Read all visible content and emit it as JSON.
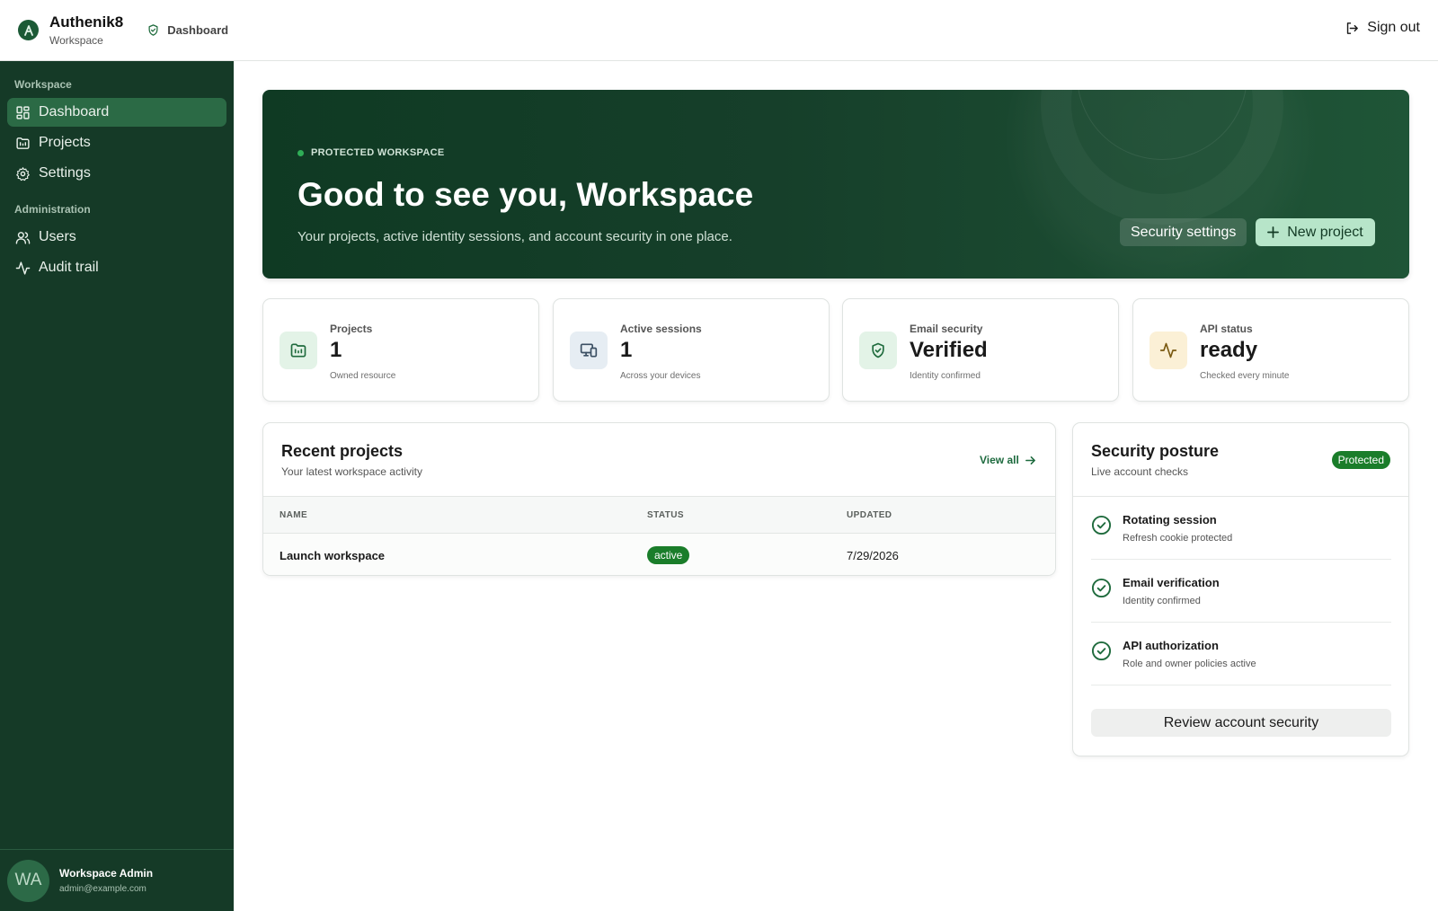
{
  "header": {
    "brand_name": "Authenik8",
    "brand_sub": "Workspace",
    "breadcrumb": "Dashboard",
    "signout_label": "Sign out"
  },
  "sidebar": {
    "sections": [
      {
        "title": "Workspace",
        "items": [
          {
            "label": "Dashboard",
            "icon": "dashboard-icon",
            "active": true
          },
          {
            "label": "Projects",
            "icon": "folder-icon"
          },
          {
            "label": "Settings",
            "icon": "gear-icon"
          }
        ]
      },
      {
        "title": "Administration",
        "items": [
          {
            "label": "Users",
            "icon": "users-icon"
          },
          {
            "label": "Audit trail",
            "icon": "activity-icon"
          }
        ]
      }
    ],
    "user": {
      "initials": "WA",
      "name": "Workspace Admin",
      "email": "admin@example.com"
    }
  },
  "hero": {
    "eyebrow": "PROTECTED WORKSPACE",
    "title": "Good to see you, Workspace",
    "subtitle": "Your projects, active identity sessions, and account security in one place.",
    "secondary_button": "Security settings",
    "primary_button": "New project"
  },
  "stats": [
    {
      "label": "Projects",
      "value": "1",
      "hint": "Owned resource",
      "icon": "folder-icon",
      "tint": "#e3f3e7",
      "color": "#1f6b3d"
    },
    {
      "label": "Active sessions",
      "value": "1",
      "hint": "Across your devices",
      "icon": "devices-icon",
      "tint": "#e6edf3",
      "color": "#3b4f63"
    },
    {
      "label": "Email security",
      "value": "Verified",
      "hint": "Identity confirmed",
      "icon": "shield-check-icon",
      "tint": "#e3f3e7",
      "color": "#1f6b3d"
    },
    {
      "label": "API status",
      "value": "ready",
      "hint": "Checked every minute",
      "icon": "activity-icon",
      "tint": "#fbf0d6",
      "color": "#7a5a12"
    }
  ],
  "recent_projects": {
    "title": "Recent projects",
    "subtitle": "Your latest workspace activity",
    "view_all": "View all",
    "columns": [
      "NAME",
      "STATUS",
      "UPDATED"
    ],
    "rows": [
      {
        "name": "Launch workspace",
        "status": "active",
        "updated": "7/29/2026"
      }
    ]
  },
  "security": {
    "title": "Security posture",
    "subtitle": "Live account checks",
    "badge": "Protected",
    "checks": [
      {
        "title": "Rotating session",
        "subtitle": "Refresh cookie protected"
      },
      {
        "title": "Email verification",
        "subtitle": "Identity confirmed"
      },
      {
        "title": "API authorization",
        "subtitle": "Role and owner policies active"
      }
    ],
    "review_button": "Review account security"
  },
  "colors": {
    "sidebar_bg": "#153a27",
    "accent": "#1f6b3d",
    "status_green": "#1a7d2a",
    "primary_button_bg": "#b7e5c9"
  }
}
